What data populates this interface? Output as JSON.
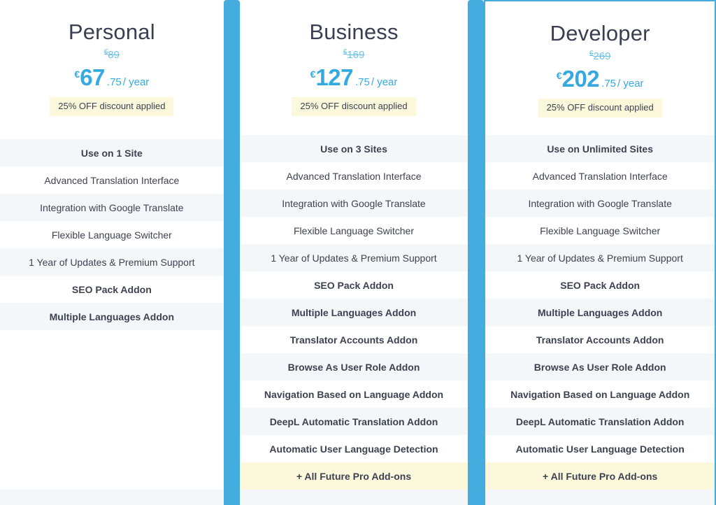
{
  "theme": {
    "accent_blue": "#45ace0",
    "price_blue": "#36a9e1",
    "old_price_blue": "#6ec1ea",
    "badge_yellow": "#fbf8dc",
    "row_alt_gray": "#f4f7f9",
    "text_dark": "#3d4251"
  },
  "plans": [
    {
      "name": "Personal",
      "old_price_currency": "€",
      "old_price": "89",
      "price_currency": "€",
      "price_amount": "67",
      "price_cents": ".75",
      "price_period": "/ year",
      "discount_badge": "25% OFF discount applied",
      "features": [
        "Use on 1 Site",
        "Advanced Translation Interface",
        "Integration with Google Translate",
        "Flexible Language Switcher",
        "1 Year of Updates & Premium Support",
        "SEO Pack Addon",
        "Multiple Languages Addon"
      ]
    },
    {
      "name": "Business",
      "old_price_currency": "€",
      "old_price": "169",
      "price_currency": "€",
      "price_amount": "127",
      "price_cents": ".75",
      "price_period": "/ year",
      "discount_badge": "25% OFF discount applied",
      "features": [
        "Use on 3 Sites",
        "Advanced Translation Interface",
        "Integration with Google Translate",
        "Flexible Language Switcher",
        "1 Year of Updates & Premium Support",
        "SEO Pack Addon",
        "Multiple Languages Addon",
        "Translator Accounts Addon",
        "Browse As User Role Addon",
        "Navigation Based on Language Addon",
        "DeepL Automatic Translation Addon",
        "Automatic User Language Detection",
        "+ All Future Pro Add-ons"
      ]
    },
    {
      "name": "Developer",
      "old_price_currency": "€",
      "old_price": "269",
      "price_currency": "€",
      "price_amount": "202",
      "price_cents": ".75",
      "price_period": "/ year",
      "discount_badge": "25% OFF discount applied",
      "features": [
        "Use on Unlimited Sites",
        "Advanced Translation Interface",
        "Integration with Google Translate",
        "Flexible Language Switcher",
        "1 Year of Updates & Premium Support",
        "SEO Pack Addon",
        "Multiple Languages Addon",
        "Translator Accounts Addon",
        "Browse As User Role Addon",
        "Navigation Based on Language Addon",
        "DeepL Automatic Translation Addon",
        "Automatic User Language Detection",
        "+ All Future Pro Add-ons"
      ]
    }
  ]
}
